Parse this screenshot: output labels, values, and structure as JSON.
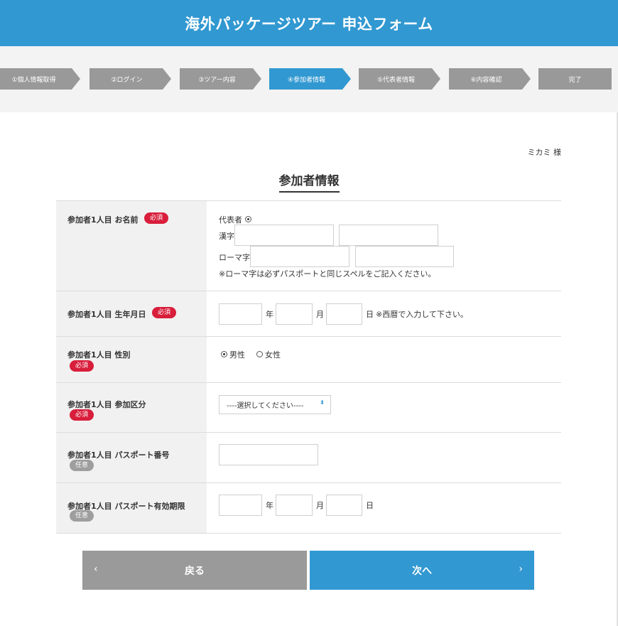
{
  "header": {
    "title": "海外パッケージツアー 申込フォーム"
  },
  "steps": [
    {
      "label": "①個人情報取得"
    },
    {
      "label": "②ログイン"
    },
    {
      "label": "③ツアー内容"
    },
    {
      "label": "④参加者情報"
    },
    {
      "label": "⑤代表者情報"
    },
    {
      "label": "⑥内容確認"
    },
    {
      "label": "完了"
    }
  ],
  "user": {
    "name": "ミカミ 様"
  },
  "page": {
    "title": "参加者情報"
  },
  "badges": {
    "required": "必須",
    "optional": "任意"
  },
  "form": {
    "name": {
      "label": "参加者1人目 お名前",
      "representative_label": "代表者",
      "kanji_label": "漢字",
      "roman_label": "ローマ字",
      "note": "※ローマ字は必ずパスポートと同じスペルをご記入ください。",
      "kanji_last": "",
      "kanji_first": "",
      "roman_last": "",
      "roman_first": ""
    },
    "birth": {
      "label": "参加者1人目 生年月日",
      "year_unit": "年",
      "month_unit": "月",
      "day_unit": "日",
      "note": "※西暦で入力して下さい。",
      "year": "",
      "month": "",
      "day": ""
    },
    "gender": {
      "label": "参加者1人目 性別",
      "male": "男性",
      "female": "女性",
      "selected": "男性"
    },
    "category": {
      "label": "参加者1人目 参加区分",
      "selected": "----選択してください----",
      "caret": "⬍"
    },
    "passport": {
      "label": "参加者1人目 パスポート番号",
      "value": ""
    },
    "passport_expiry": {
      "label": "参加者1人目 パスポート有効期限",
      "year_unit": "年",
      "month_unit": "月",
      "day_unit": "日",
      "year": "",
      "month": "",
      "day": ""
    }
  },
  "buttons": {
    "back": {
      "label": "戻る",
      "icon": "‹"
    },
    "next": {
      "label": "次へ",
      "icon": "›"
    }
  },
  "colors": {
    "primary": "#3198d1",
    "step_gray": "#999999",
    "required": "#d81e3b",
    "optional": "#9e9e9e",
    "back_button": "#9a9a9a"
  }
}
